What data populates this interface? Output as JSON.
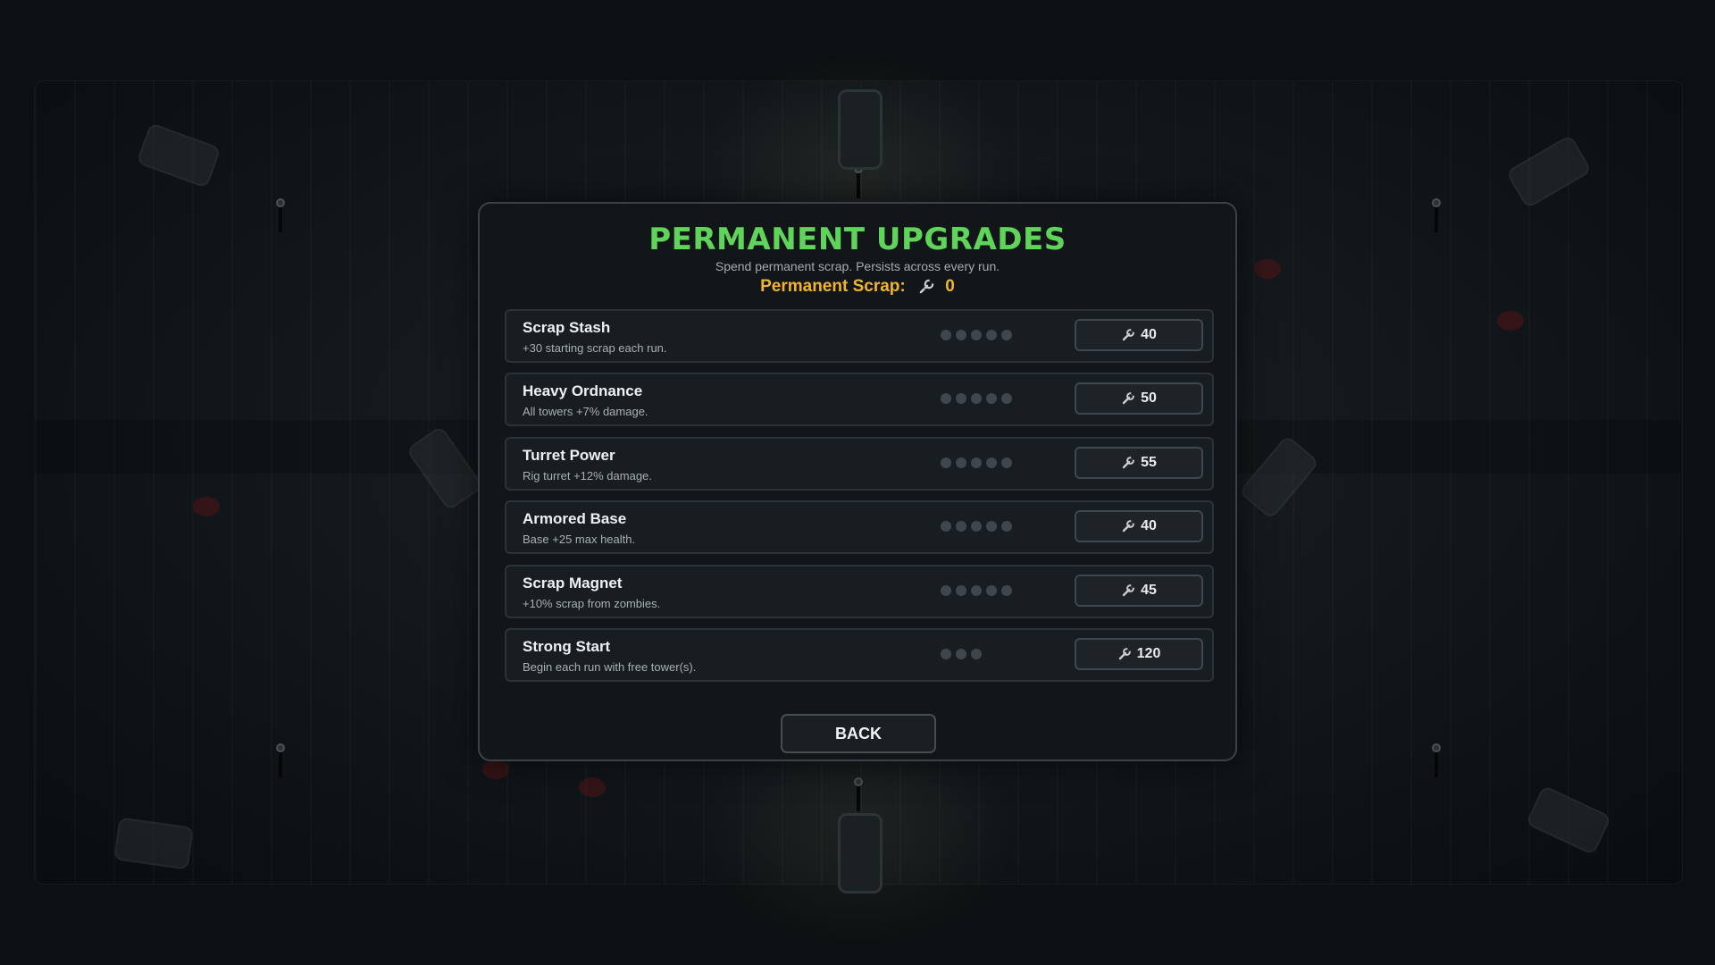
{
  "modal": {
    "title": "PERMANENT UPGRADES",
    "subtitle": "Spend permanent scrap. Persists across every run.",
    "scrap_label": "Permanent Scrap:",
    "scrap_amount": "0",
    "currency_icon": "scrap-wrench-icon"
  },
  "upgrades": [
    {
      "name": "Scrap Stash",
      "description": "+30 starting scrap each run.",
      "levels_total": 5,
      "levels_owned": 0,
      "cost": "40"
    },
    {
      "name": "Heavy Ordnance",
      "description": "All towers +7% damage.",
      "levels_total": 5,
      "levels_owned": 0,
      "cost": "50"
    },
    {
      "name": "Turret Power",
      "description": "Rig turret +12% damage.",
      "levels_total": 5,
      "levels_owned": 0,
      "cost": "55"
    },
    {
      "name": "Armored Base",
      "description": "Base +25 max health.",
      "levels_total": 5,
      "levels_owned": 0,
      "cost": "40"
    },
    {
      "name": "Scrap Magnet",
      "description": "+10% scrap from zombies.",
      "levels_total": 5,
      "levels_owned": 0,
      "cost": "45"
    },
    {
      "name": "Strong Start",
      "description": "Begin each run with free tower(s).",
      "levels_total": 3,
      "levels_owned": 0,
      "cost": "120"
    }
  ],
  "back_button": {
    "label": "BACK"
  },
  "colors": {
    "title": "#5fd35a",
    "scrap": "#f0b52a",
    "dot_empty": "#3f474c",
    "panel_bg": "#121619",
    "panel_border": "#3b4247"
  }
}
